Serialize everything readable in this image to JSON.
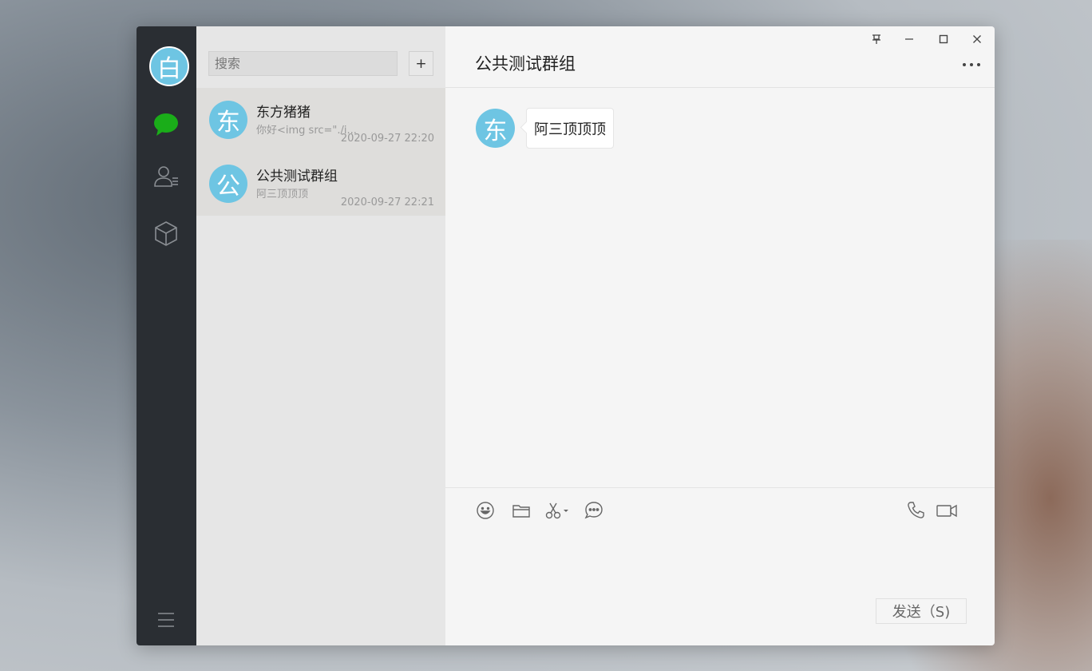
{
  "user": {
    "avatar_char": "白"
  },
  "search": {
    "placeholder": "搜索",
    "add_label": "+"
  },
  "conversations": [
    {
      "avatar_char": "东",
      "name": "东方猪猪",
      "preview": "你好<img src=\"./i...",
      "time": "2020-09-27 22:20"
    },
    {
      "avatar_char": "公",
      "name": "公共测试群组",
      "preview": "阿三顶顶顶",
      "time": "2020-09-27 22:21"
    }
  ],
  "chat": {
    "title": "公共测试群组",
    "messages": [
      {
        "avatar_char": "东",
        "text": "阿三顶顶顶"
      }
    ],
    "send_label": "发送（S)"
  },
  "colors": {
    "rail_bg": "#2a2e33",
    "accent_green": "#1aad19",
    "avatar_bg": "#6ec5e3",
    "list_bg": "#e6e6e6",
    "chat_bg": "#f5f5f5"
  }
}
